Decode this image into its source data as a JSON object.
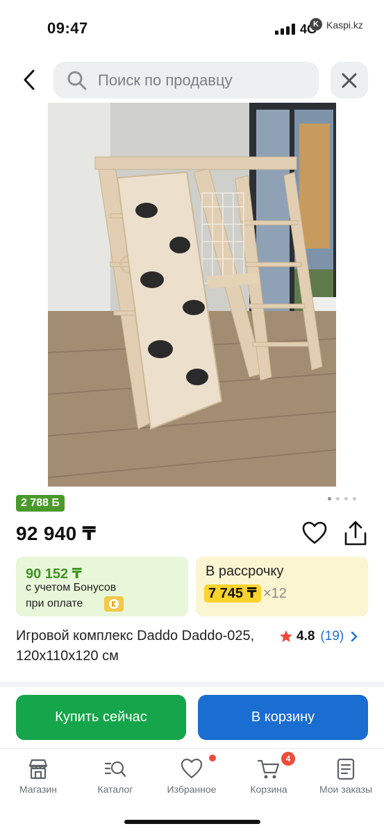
{
  "status_bar": {
    "time": "09:47",
    "network": "4G",
    "carrier_label": "Kaspi.kz"
  },
  "search": {
    "placeholder": "Поиск по продавцу"
  },
  "product": {
    "bonus_badge": "2 788 Ƃ",
    "price": "92 940 ₸",
    "bonus_card": {
      "amount": "90 152 ₸",
      "line1": "с учетом Бонусов",
      "line2": "при оплате"
    },
    "installment_card": {
      "title": "В рассрочку",
      "monthly": "7 745 ₸",
      "months": "×12"
    },
    "title": "Игровой комплекс Daddo Daddo-025, 120x110x120 см",
    "rating": "4.8",
    "reviews": "(19)",
    "image_dots": {
      "count": 4,
      "active_index": 0
    }
  },
  "actions": {
    "buy_now": "Купить сейчас",
    "add_to_cart": "В корзину"
  },
  "tabbar": {
    "items": [
      {
        "label": "Магазин",
        "icon": "store-icon"
      },
      {
        "label": "Каталог",
        "icon": "catalog-search-icon"
      },
      {
        "label": "Избранное",
        "icon": "heart-icon"
      },
      {
        "label": "Корзина",
        "icon": "cart-icon",
        "badge": "4"
      },
      {
        "label": "Мои заказы",
        "icon": "orders-icon"
      }
    ]
  },
  "colors": {
    "green_accent": "#15a54a",
    "blue_accent": "#1a6dd1",
    "bonus_green": "#4a9a2a",
    "installment_yellow": "#fbd32b",
    "badge_red": "#f04a3a"
  }
}
